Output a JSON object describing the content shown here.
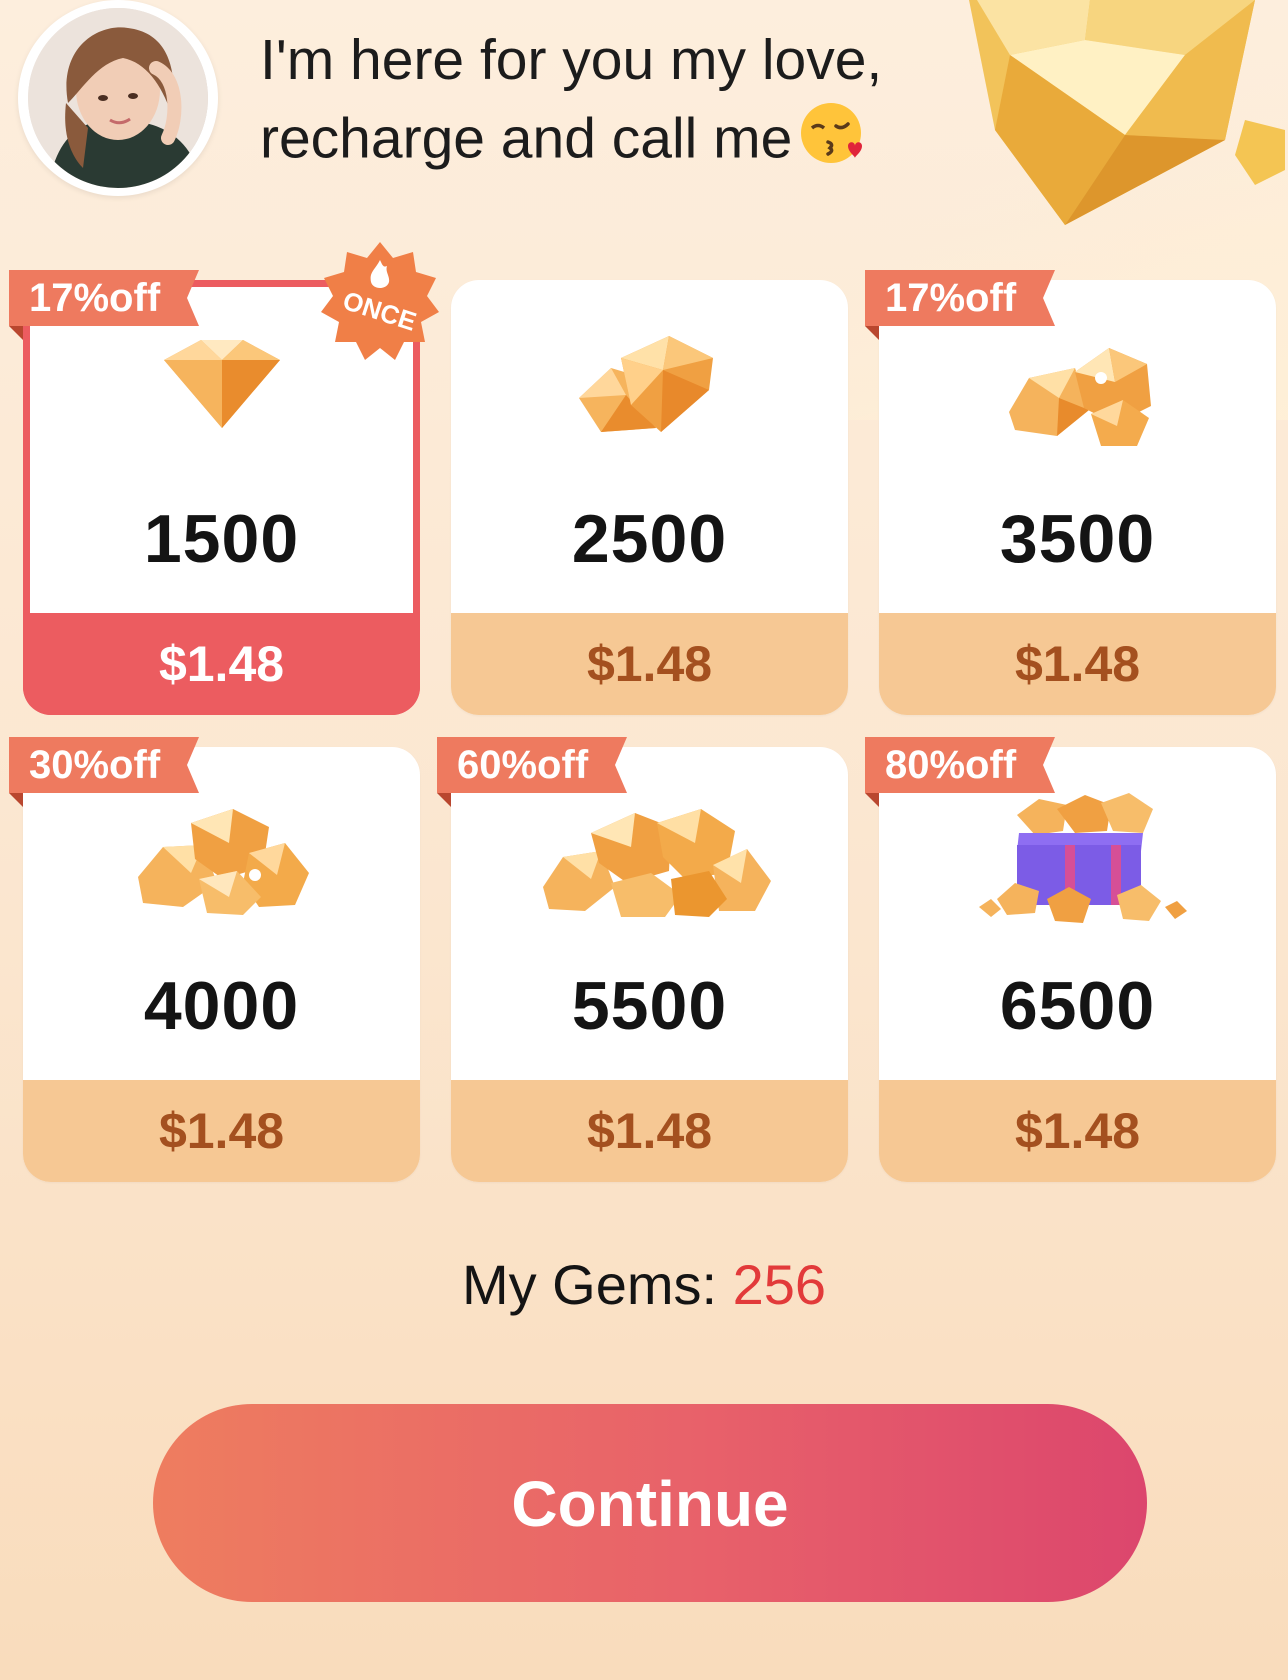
{
  "header": {
    "message_line1": "I'm here for you my love,",
    "message_line2": "recharge and call me"
  },
  "packages": [
    {
      "gems": "1500",
      "price": "$1.48",
      "discount": "17%off",
      "badge": "ONCE",
      "selected": true
    },
    {
      "gems": "2500",
      "price": "$1.48",
      "discount": "",
      "badge": "",
      "selected": false
    },
    {
      "gems": "3500",
      "price": "$1.48",
      "discount": "17%off",
      "badge": "",
      "selected": false
    },
    {
      "gems": "4000",
      "price": "$1.48",
      "discount": "30%off",
      "badge": "",
      "selected": false
    },
    {
      "gems": "5500",
      "price": "$1.48",
      "discount": "60%off",
      "badge": "",
      "selected": false
    },
    {
      "gems": "6500",
      "price": "$1.48",
      "discount": "80%off",
      "badge": "",
      "selected": false
    }
  ],
  "summary": {
    "label": "My Gems:",
    "count": "256"
  },
  "continue_label": "Continue",
  "colors": {
    "accent": "#ec5c60",
    "price_bar": "#f6c894",
    "price_text": "#a4501f",
    "gem_count": "#e23a3a"
  },
  "icons": {
    "avatar": "user-avatar-photo",
    "emoji": "kissing-face-emoji",
    "badge": "fire-icon"
  }
}
